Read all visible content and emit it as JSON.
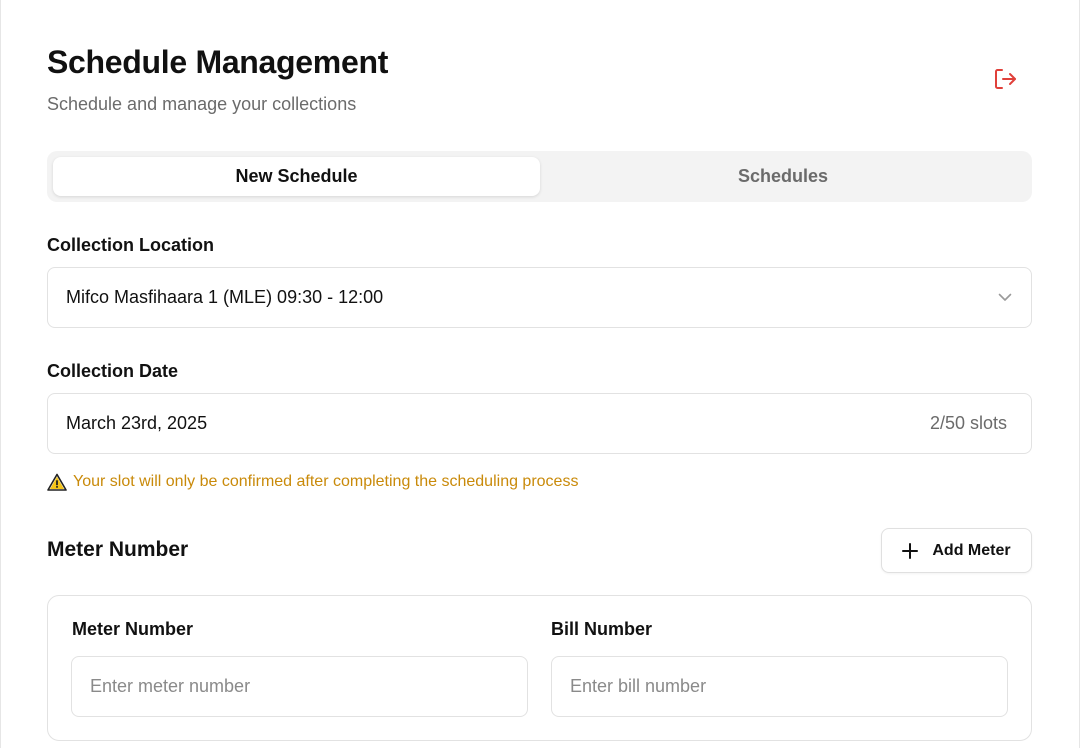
{
  "header": {
    "title": "Schedule Management",
    "subtitle": "Schedule and manage your collections",
    "logout_icon": "logout-icon",
    "accent_color": "#e0403a"
  },
  "tabs": [
    {
      "label": "New Schedule",
      "active": true
    },
    {
      "label": "Schedules",
      "active": false
    }
  ],
  "collection_location": {
    "label": "Collection Location",
    "value": "Mifco Masfihaara 1 (MLE) 09:30 - 12:00",
    "icon": "chevron-down-icon"
  },
  "collection_date": {
    "label": "Collection Date",
    "value": "March 23rd, 2025",
    "slots": "2/50 slots"
  },
  "warning": {
    "icon": "warning-icon",
    "text": "Your slot will only be confirmed after completing the scheduling process",
    "color": "#c98a0a"
  },
  "meter_section": {
    "title": "Meter Number",
    "add_button_label": "Add Meter",
    "add_icon": "plus-icon",
    "meter_label": "Meter Number",
    "meter_placeholder": "Enter meter number",
    "bill_label": "Bill Number",
    "bill_placeholder": "Enter bill number"
  }
}
